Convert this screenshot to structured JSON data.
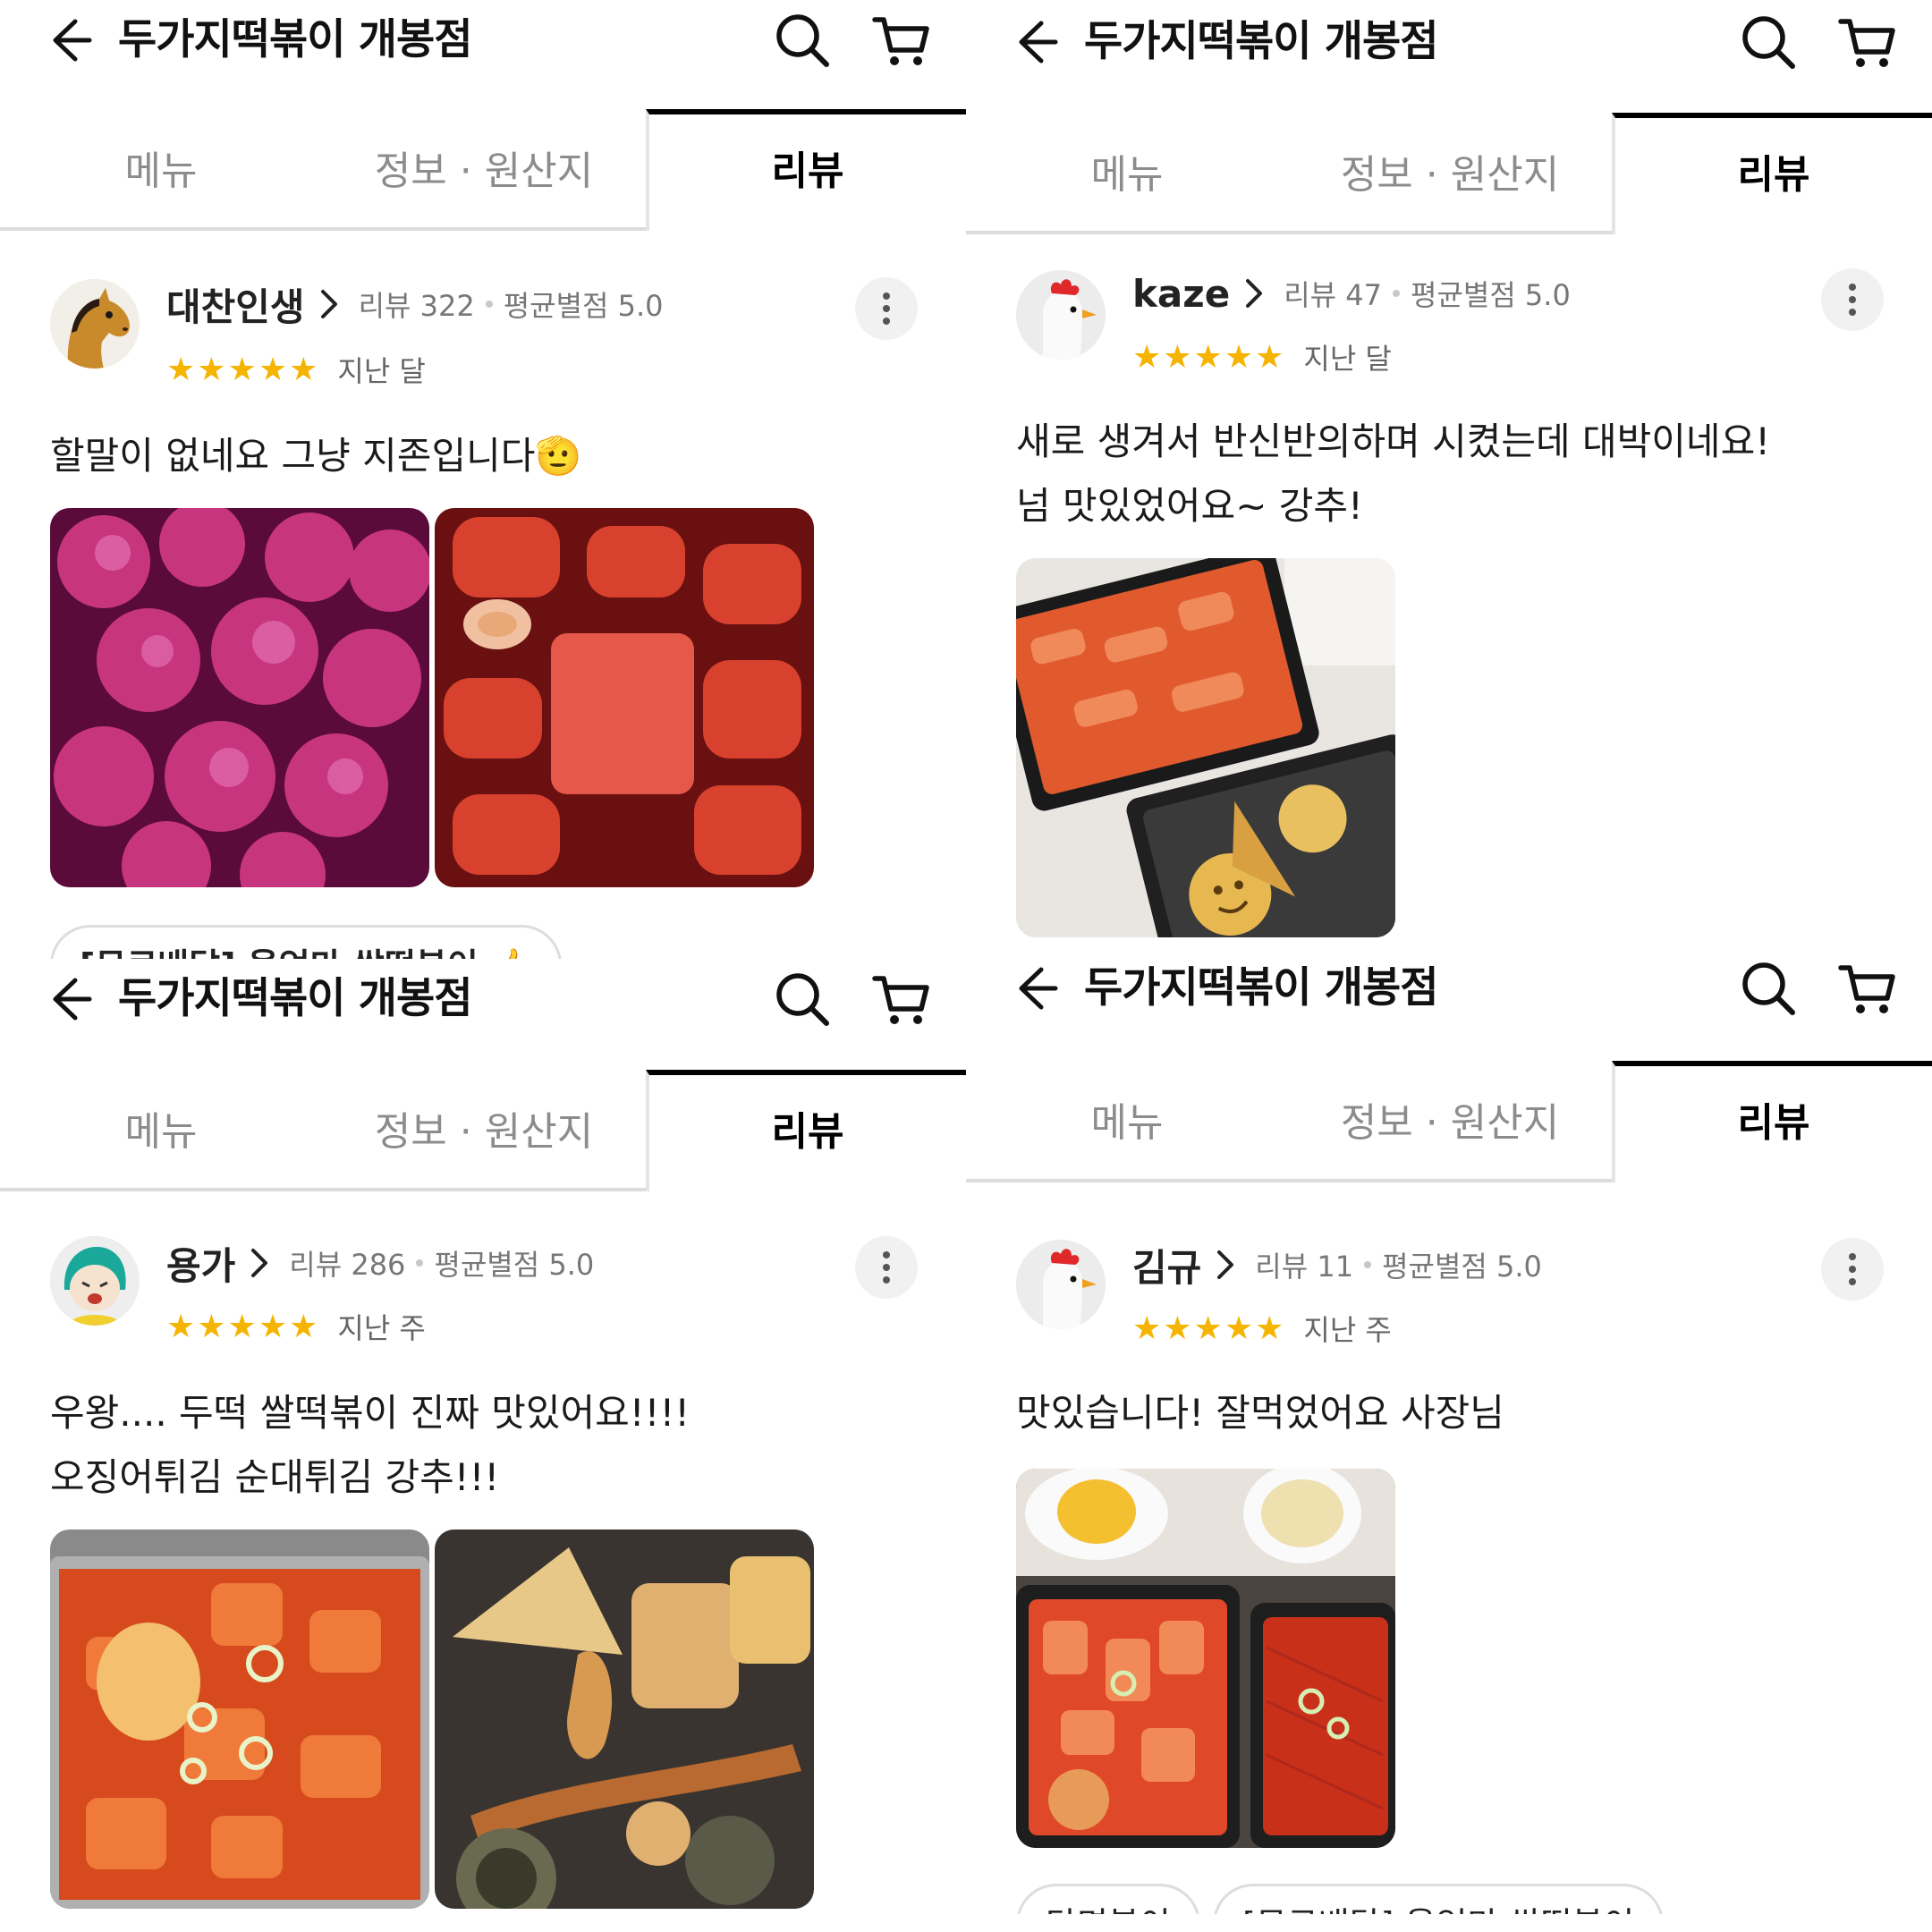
{
  "header": {
    "store_title": "두가지떡볶이 개봉점",
    "icons": {
      "back": "arrow-left-icon",
      "search": "search-icon",
      "cart": "cart-icon"
    }
  },
  "tabs": [
    {
      "label": "메뉴",
      "active": false
    },
    {
      "label": "정보 · 원산지",
      "active": false
    },
    {
      "label": "리뷰",
      "active": true
    }
  ],
  "colors": {
    "star": "#f5b400",
    "active_tab_border": "#000000",
    "inactive_tab_text": "#8c8c8c"
  },
  "reviews": [
    {
      "user": "대찬인생",
      "review_count_label": "리뷰 322",
      "avg_rating_label": "평균별점 5.0",
      "stars": "★★★★★",
      "rating": 5,
      "when": "지난 달",
      "text_lines": [
        "할말이 없네요 그냥 지존입니다🫡"
      ],
      "photo_count": 2,
      "menu_chips": [
        "[무료배달] 울엄마 쌀떡볶이 👍"
      ]
    },
    {
      "user": "kaze",
      "review_count_label": "리뷰 47",
      "avg_rating_label": "평균별점 5.0",
      "stars": "★★★★★",
      "rating": 5,
      "when": "지난 달",
      "text_lines": [
        "새로 생겨서 반신반의하며 시켰는데 대박이네요!",
        "넘 맛있었어요~ 강추!"
      ],
      "photo_count": 1,
      "menu_chips": []
    },
    {
      "user": "용가",
      "review_count_label": "리뷰 286",
      "avg_rating_label": "평균별점 5.0",
      "stars": "★★★★★",
      "rating": 5,
      "when": "지난 주",
      "text_lines": [
        "우왕.... 두떡 쌀떡볶이 진짜 맛있어요!!!!",
        "오징어튀김 순대튀김 강추!!!"
      ],
      "photo_count": 2,
      "menu_chips": []
    },
    {
      "user": "김규",
      "review_count_label": "리뷰 11",
      "avg_rating_label": "평균별점 5.0",
      "stars": "★★★★★",
      "rating": 5,
      "when": "지난 주",
      "text_lines": [
        "맛있습니다! 잘먹었어요 사장님"
      ],
      "photo_count": 1,
      "menu_chips": [
        "당면볶이",
        "[무료배달] 울엄마 쌀떡볶이"
      ]
    }
  ]
}
